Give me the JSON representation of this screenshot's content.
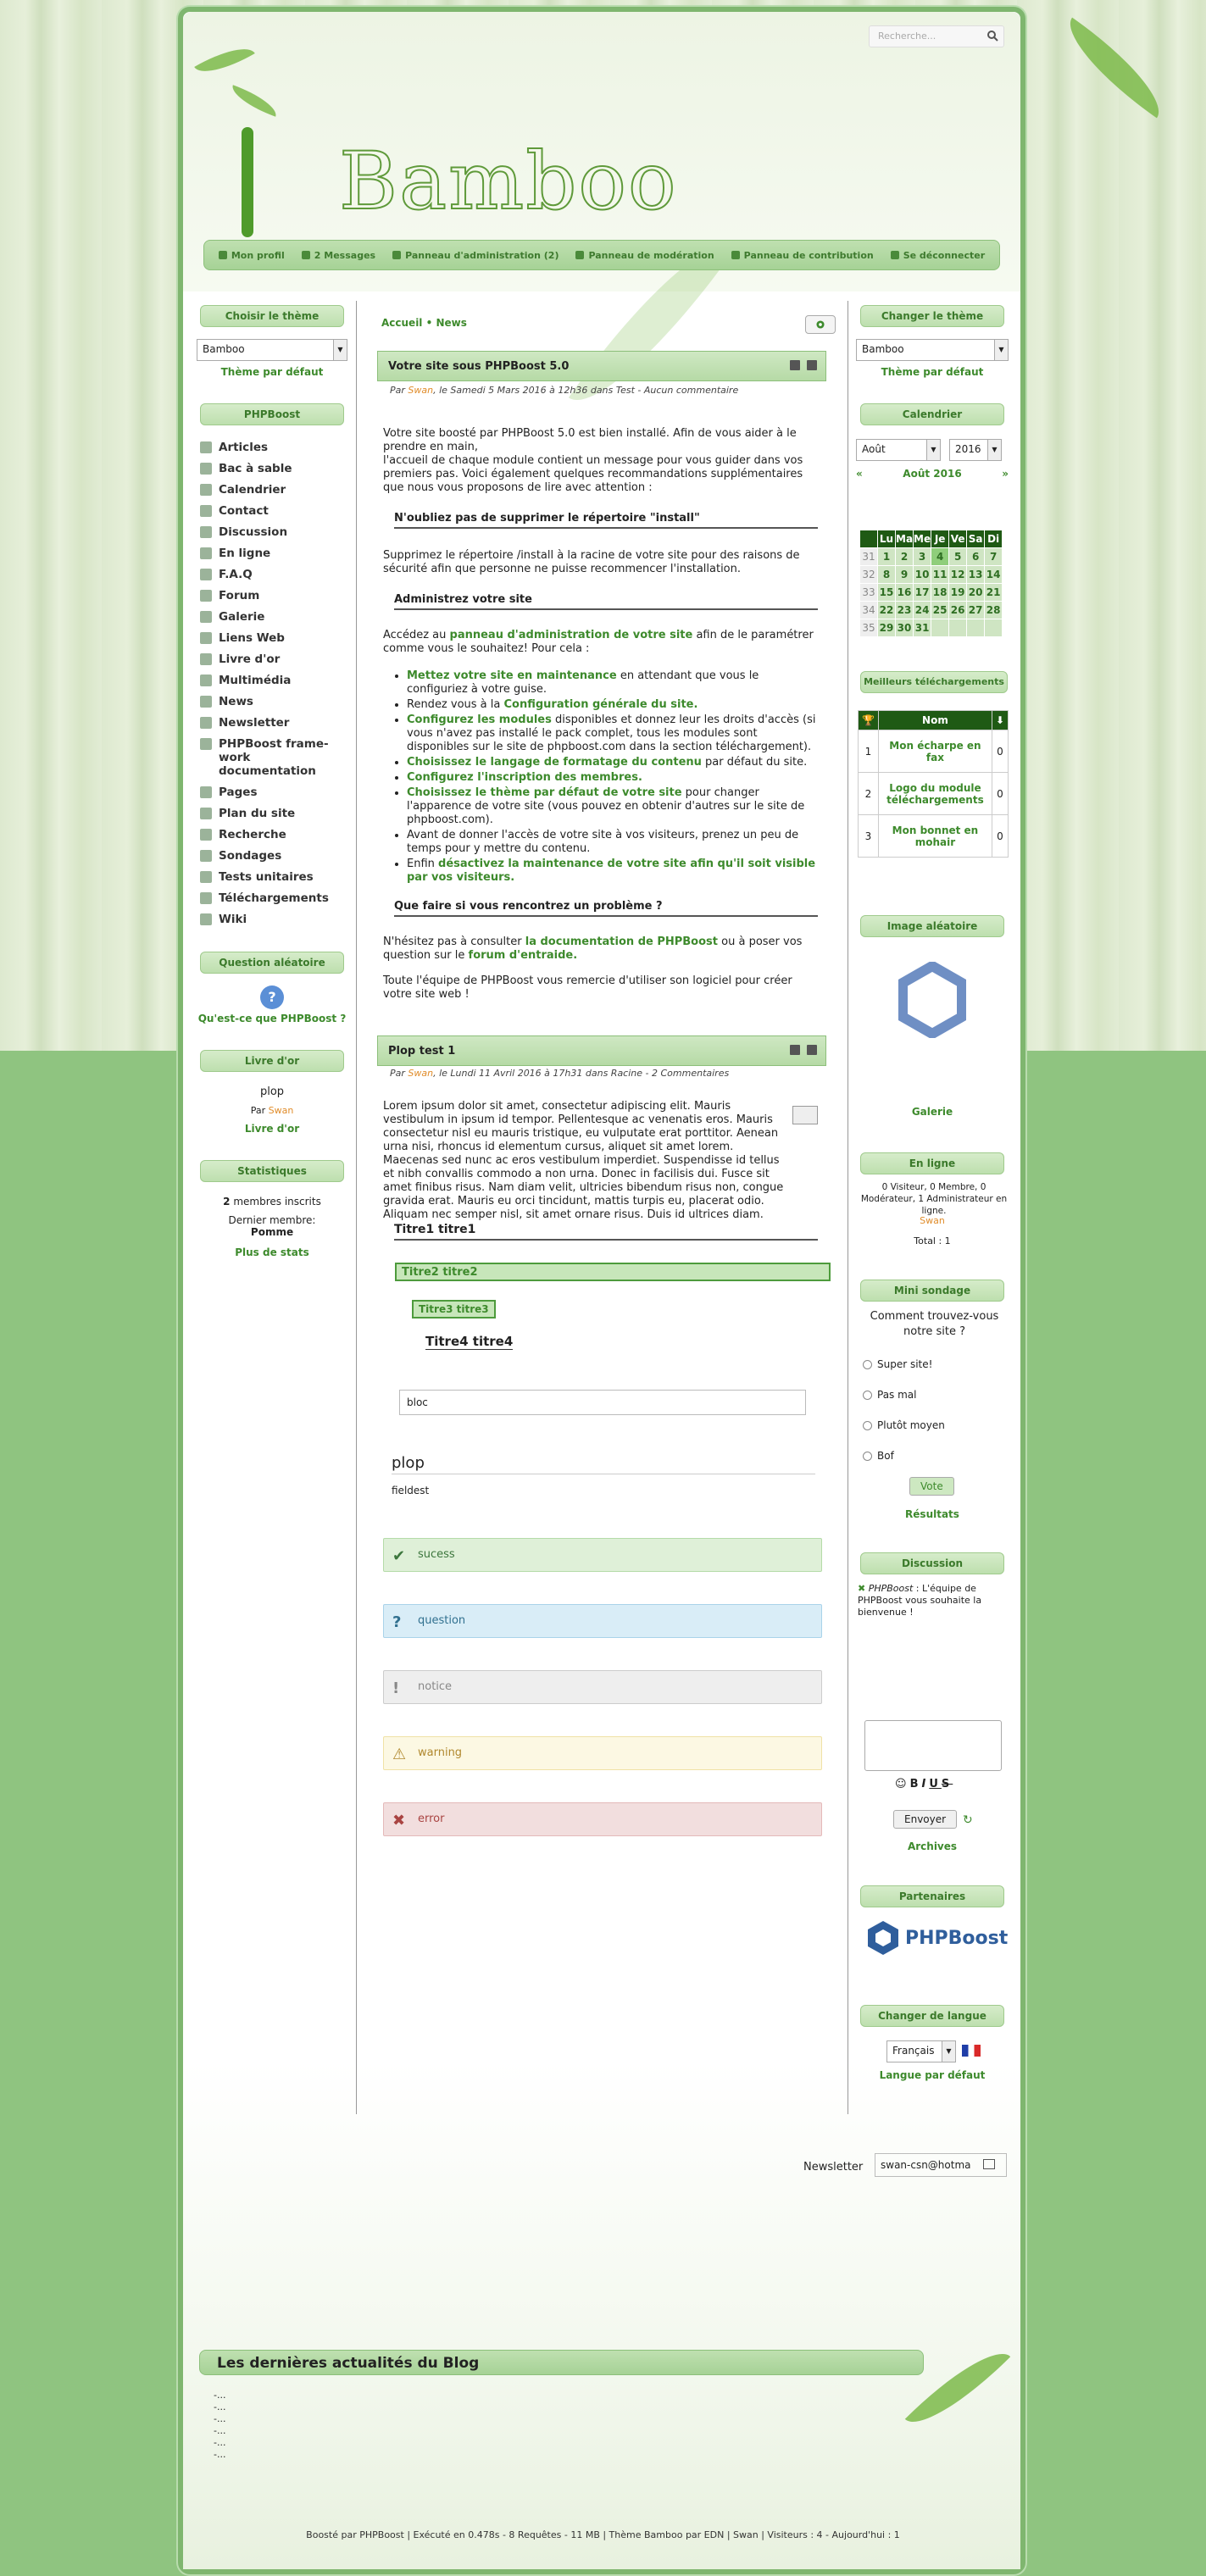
{
  "search": {
    "placeholder": "Recherche..."
  },
  "site_title": "Bamboo",
  "nav": [
    "Mon profil",
    "2 Messages",
    "Panneau d'administration (2)",
    "Panneau de modération",
    "Panneau de contribution",
    "Se déconnecter"
  ],
  "left": {
    "theme_title": "Choisir le thème",
    "theme_value": "Bamboo",
    "theme_default": "Thème par défaut",
    "phpboost_title": "PHPBoost",
    "menu": [
      "Articles",
      "Bac à sable",
      "Calendrier",
      "Contact",
      "Discussion",
      "En ligne",
      "F.A.Q",
      "Forum",
      "Galerie",
      "Liens Web",
      "Livre d'or",
      "Multimédia",
      "News",
      "Newsletter",
      "PHPBoost frame-work documentation",
      "Pages",
      "Plan du site",
      "Recherche",
      "Sondages",
      "Tests unitaires",
      "Téléchargements",
      "Wiki"
    ],
    "question_title": "Question aléatoire",
    "question_link": "Qu'est-ce que PHPBoost ?",
    "guestbook_title": "Livre d'or",
    "guestbook_msg": "plop",
    "guestbook_by": "Par",
    "guestbook_author": "Swan",
    "guestbook_link": "Livre d'or",
    "stats_title": "Statistiques",
    "stats_members_num": "2",
    "stats_members": "membres inscrits",
    "stats_last": "Dernier membre:",
    "stats_last_name": "Pomme",
    "stats_more": "Plus de stats"
  },
  "main": {
    "breadcrumb": [
      "Accueil",
      "News"
    ],
    "article1": {
      "title": "Votre site sous PHPBoost 5.0",
      "meta_par": "Par",
      "meta_author": "Swan",
      "meta_rest": ", le Samedi 5 Mars 2016 à 12h36 dans Test - Aucun commentaire",
      "p1": "Votre site boosté par PHPBoost 5.0 est bien installé. Afin de vous aider à le prendre en main,",
      "p1b": "l'accueil de chaque module contient un message pour vous guider dans vos premiers pas. Voici également quelques recommandations supplémentaires que nous vous proposons de lire avec attention :",
      "h1": "N'oubliez pas de supprimer le répertoire \"install\"",
      "p2": "Supprimez le répertoire /install à la racine de votre site pour des raisons de sécurité afin que personne ne puisse recommencer l'installation.",
      "h2": "Administrez votre site",
      "p3a": "Accédez au",
      "p3link": "panneau d'administration de votre site",
      "p3b": "afin de le paramétrer comme vous le souhaitez! Pour cela :",
      "list": [
        [
          "Mettez votre site en maintenance",
          " en attendant que vous le configuriez à votre guise."
        ],
        [
          "Rendez vous à la ",
          "Configuration générale du site."
        ],
        [
          "Configurez les modules",
          " disponibles et donnez leur les droits d'accès (si vous n'avez pas installé le pack complet, tous les modules sont disponibles sur le site de phpboost.com dans la section téléchargement)."
        ],
        [
          "Choisissez le langage de formatage du contenu",
          " par défaut du site."
        ],
        [
          "Configurez l'inscription des membres.",
          ""
        ],
        [
          "Choisissez le thème par défaut de votre site",
          " pour changer l'apparence de votre site (vous pouvez en obtenir d'autres sur le site de phpboost.com)."
        ],
        [
          "Avant de donner l'accès de votre site à vos visiteurs, prenez un peu de temps pour y mettre du contenu.",
          ""
        ],
        [
          "Enfin ",
          "désactivez la maintenance de votre site afin qu'il soit visible par vos visiteurs."
        ]
      ],
      "h3": "Que faire si vous rencontrez un problème ?",
      "p4a": "N'hésitez pas à consulter",
      "p4link1": "la documentation de PHPBoost",
      "p4b": "ou à poser vos question sur le",
      "p4link2": "forum d'entraide.",
      "p5": "Toute l'équipe de PHPBoost vous remercie d'utiliser son logiciel pour créer votre site web !"
    },
    "article2": {
      "title": "Plop test 1",
      "meta_par": "Par",
      "meta_author": "Swan",
      "meta_rest": ", le Lundi 11 Avril 2016 à 17h31 dans Racine - 2 Commentaires",
      "lorem": "Lorem ipsum dolor sit amet, consectetur adipiscing elit. Mauris vestibulum in ipsum id tempor. Pellentesque ac venenatis eros. Mauris consectetur nisl eu mauris tristique, eu vulputate erat porttitor. Aenean urna nisi, rhoncus id elementum cursus, aliquet sit amet lorem. Maecenas sed nunc ac eros vestibulum imperdiet. Suspendisse id tellus et nibh convallis commodo a non urna. Donec in facilisis dui. Fusce sit amet finibus risus. Nam diam velit, ultricies bibendum risus non, congue gravida erat. Mauris eu orci tincidunt, mattis turpis eu, placerat odio. Aliquam nec semper nisl, sit amet ornare risus. Duis id ultrices diam.",
      "t1": "Titre1 titre1",
      "t2": "Titre2 titre2",
      "t3": "Titre3 titre3",
      "t4": "Titre4 titre4",
      "bloc": "bloc",
      "fieldset_legend": "plop",
      "fieldset_body": "fieldest",
      "alerts": {
        "success": "sucess",
        "question": "question",
        "notice": "notice",
        "warning": "warning",
        "error": "error"
      }
    }
  },
  "right": {
    "theme_title": "Changer le thème",
    "theme_value": "Bamboo",
    "theme_default": "Thème par défaut",
    "calendar_title": "Calendrier",
    "cal_month": "Août",
    "cal_year": "2016",
    "cal_header": "Août 2016",
    "cal_days": [
      "Lu",
      "Ma",
      "Me",
      "Je",
      "Ve",
      "Sa",
      "Di"
    ],
    "cal_rows": [
      [
        "31",
        "1",
        "2",
        "3",
        "4",
        "5",
        "6",
        "7"
      ],
      [
        "32",
        "8",
        "9",
        "10",
        "11",
        "12",
        "13",
        "14"
      ],
      [
        "33",
        "15",
        "16",
        "17",
        "18",
        "19",
        "20",
        "21"
      ],
      [
        "34",
        "22",
        "23",
        "24",
        "25",
        "26",
        "27",
        "28"
      ],
      [
        "35",
        "29",
        "30",
        "31",
        "",
        "",
        "",
        ""
      ]
    ],
    "dl_title": "Meilleurs téléchargements",
    "dl_col": "Nom",
    "dl_rows": [
      [
        "1",
        "Mon écharpe en fax",
        "0"
      ],
      [
        "2",
        "Logo du module téléchargements",
        "0"
      ],
      [
        "3",
        "Mon bonnet en mohair",
        "0"
      ]
    ],
    "img_title": "Image aléatoire",
    "img_link": "Galerie",
    "online_title": "En ligne",
    "online_text": "0 Visiteur, 0 Membre, 0 Modérateur, 1 Administrateur en ligne.",
    "online_user": "Swan",
    "online_total": "Total : 1",
    "poll_title": "Mini sondage",
    "poll_q": "Comment trouvez-vous notre site ?",
    "poll_opts": [
      "Super site!",
      "Pas mal",
      "Plutôt moyen",
      "Bof"
    ],
    "poll_vote": "Vote",
    "poll_results": "Résultats",
    "shout_title": "Discussion",
    "shout_author": "PHPBoost",
    "shout_msg": " : L'équipe de PHPBoost vous souhaite la bienvenue !",
    "shout_send": "Envoyer",
    "shout_archives": "Archives",
    "partners_title": "Partenaires",
    "partners_logo": "PHPBoost",
    "lang_title": "Changer de langue",
    "lang_value": "Français",
    "lang_default": "Langue par défaut"
  },
  "newsletter": {
    "label": "Newsletter",
    "value": "swan-csn@hotma"
  },
  "blog": {
    "title": "Les dernières actualités du Blog",
    "items": [
      "-...",
      "-...",
      "-...",
      "-...",
      "-...",
      "-..."
    ]
  },
  "footer": {
    "text": "Boosté par PHPBoost | Exécuté en 0.478s - 8 Requêtes - 11 MB | Thème Bamboo par EDN | Swan | Visiteurs : 4 - Aujourd'hui : 1"
  },
  "colors": {
    "accent": "#3d8a2c",
    "header_green": "#1f5a14",
    "author": "#e08c2a"
  }
}
